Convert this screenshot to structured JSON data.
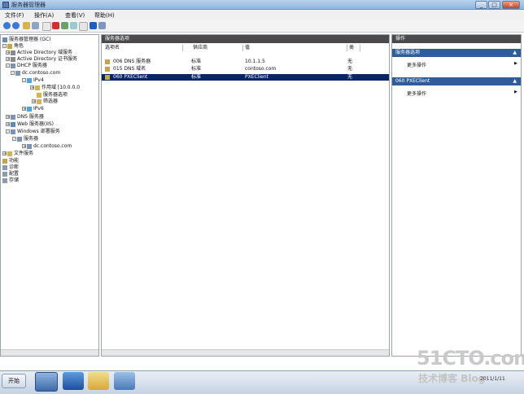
{
  "window": {
    "title": "服务器管理器"
  },
  "menu": [
    "文件(F)",
    "操作(A)",
    "查看(V)",
    "帮助(H)"
  ],
  "tree": {
    "items": [
      {
        "label": "服务器管理器 (GC)"
      },
      {
        "label": "角色"
      },
      {
        "label": "Active Directory 域服务"
      },
      {
        "label": "Active Directory 证书服务"
      },
      {
        "label": "DHCP 服务器"
      },
      {
        "label": "dc.contoso.com"
      },
      {
        "label": "IPv4"
      },
      {
        "label": "作用域 [10.0.0.0"
      },
      {
        "label": "服务器选项"
      },
      {
        "label": "筛选器"
      },
      {
        "label": "IPv6"
      },
      {
        "label": "DNS 服务器"
      },
      {
        "label": "Web 服务器(IIS)"
      },
      {
        "label": "Windows 部署服务"
      },
      {
        "label": "服务器"
      },
      {
        "label": "dc.contoso.com"
      },
      {
        "label": "文件服务"
      },
      {
        "label": "功能"
      },
      {
        "label": "诊断"
      },
      {
        "label": "配置"
      },
      {
        "label": "存储"
      }
    ]
  },
  "center": {
    "header": "服务器选项",
    "columns": [
      "选项名",
      "供应商",
      "值",
      "类"
    ],
    "rows": [
      {
        "name": "006 DNS 服务器",
        "vendor": "标准",
        "value": "10.1.1.5",
        "class": "无"
      },
      {
        "name": "015 DNS 域名",
        "vendor": "标准",
        "value": "contoso.com",
        "class": "无"
      },
      {
        "name": "060 PXEClient",
        "vendor": "标准",
        "value": "PXEClient",
        "class": "无"
      }
    ]
  },
  "actions": {
    "header": "操作",
    "sections": [
      {
        "title": "服务器选项",
        "item": "更多操作"
      },
      {
        "title": "060 PXEClient",
        "item": "更多操作"
      }
    ]
  },
  "taskbar": {
    "start": "开始",
    "date": "2011/1/11"
  },
  "watermark": {
    "site": "51CTO.com",
    "sub": "技术博客 Blog"
  }
}
